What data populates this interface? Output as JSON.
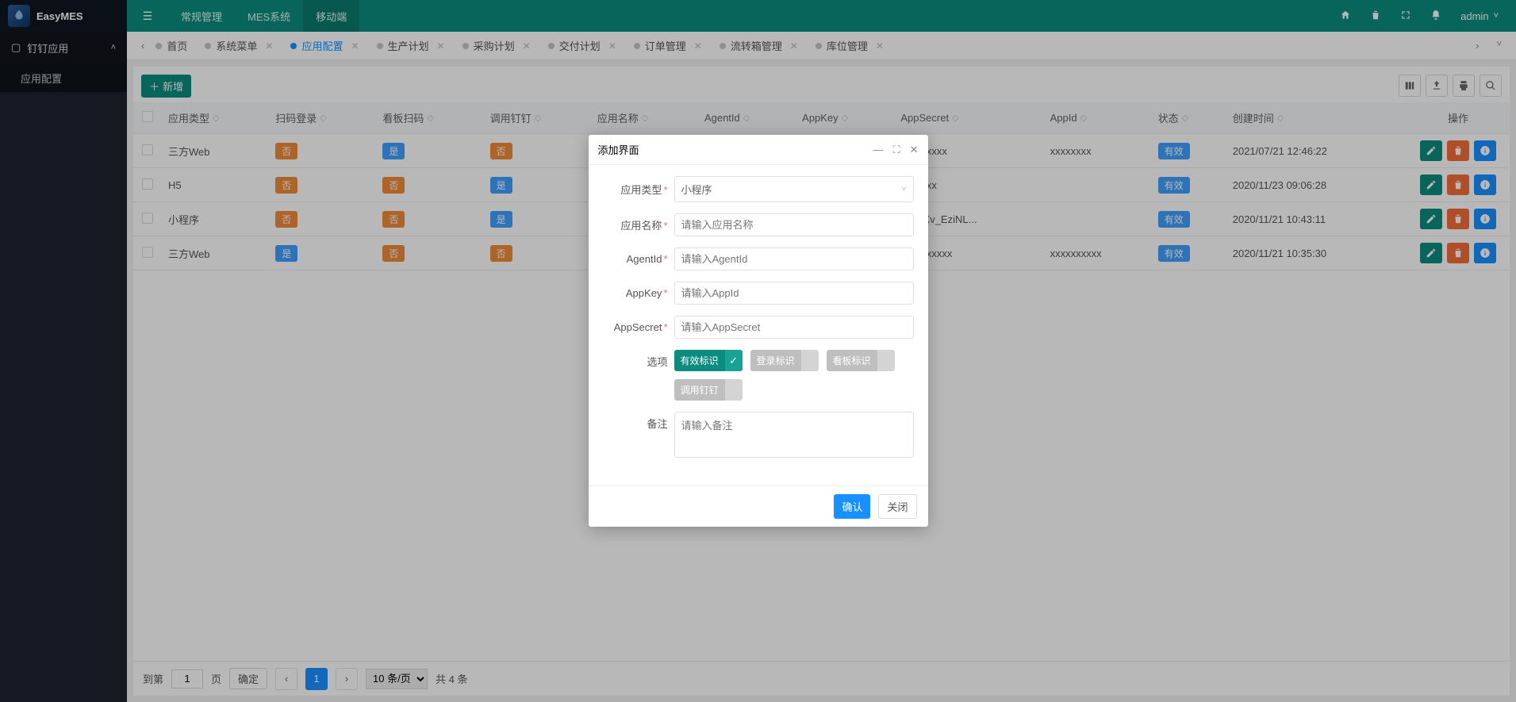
{
  "brand": "EasyMES",
  "sidebar": {
    "group": "钉钉应用",
    "items": [
      {
        "label": "应用配置"
      }
    ]
  },
  "nav": {
    "tabs": [
      "常规管理",
      "MES系统",
      "移动端"
    ],
    "activeIndex": 2
  },
  "user": {
    "name": "admin"
  },
  "pageTabs": {
    "items": [
      {
        "label": "首页",
        "closable": false
      },
      {
        "label": "系统菜单",
        "closable": true
      },
      {
        "label": "应用配置",
        "closable": true,
        "active": true
      },
      {
        "label": "生产计划",
        "closable": true
      },
      {
        "label": "采购计划",
        "closable": true
      },
      {
        "label": "交付计划",
        "closable": true
      },
      {
        "label": "订单管理",
        "closable": true
      },
      {
        "label": "流转箱管理",
        "closable": true
      },
      {
        "label": "库位管理",
        "closable": true
      }
    ]
  },
  "toolbar": {
    "addLabel": "新增"
  },
  "table": {
    "columns": [
      "应用类型",
      "扫码登录",
      "看板扫码",
      "调用钉钉",
      "应用名称",
      "AgentId",
      "AppKey",
      "AppSecret",
      "AppId",
      "状态",
      "创建时间",
      "操作"
    ],
    "rows": [
      {
        "appType": "三方Web",
        "scanLogin": "否",
        "boardScan": "是",
        "callDing": "否",
        "appName": "",
        "agentId": "",
        "appKey": "",
        "appSecret": "xxxxxxxxx",
        "appId": "xxxxxxxx",
        "status": "有效",
        "created": "2021/07/21 12:46:22"
      },
      {
        "appType": "H5",
        "scanLogin": "否",
        "boardScan": "否",
        "callDing": "是",
        "appName": "",
        "agentId": "",
        "appKey": "",
        "appSecret": "xxxxxxx",
        "appId": "",
        "status": "有效",
        "created": "2020/11/23 09:06:28"
      },
      {
        "appType": "小程序",
        "scanLogin": "否",
        "boardScan": "否",
        "callDing": "是",
        "appName": "",
        "agentId": "",
        "appKey": "",
        "appSecret": "RUCXv_EziNL...",
        "appId": "",
        "status": "有效",
        "created": "2020/11/21 10:43:11"
      },
      {
        "appType": "三方Web",
        "scanLogin": "是",
        "boardScan": "否",
        "callDing": "否",
        "appName": "",
        "agentId": "",
        "appKey": "",
        "appSecret": "xxxxxxxxxx",
        "appId": "xxxxxxxxxx",
        "status": "有效",
        "created": "2020/11/21 10:35:30"
      }
    ],
    "tag_yes": "是",
    "tag_no": "否"
  },
  "pager": {
    "gotoLabel": "到第",
    "pageLabel": "页",
    "confirm": "确定",
    "current": "1",
    "perPage": "10 条/页",
    "total": "共 4 条"
  },
  "modal": {
    "title": "添加界面",
    "fields": {
      "appType": {
        "label": "应用类型",
        "value": "小程序"
      },
      "appName": {
        "label": "应用名称",
        "placeholder": "请输入应用名称"
      },
      "agentId": {
        "label": "AgentId",
        "placeholder": "请输入AgentId"
      },
      "appKey": {
        "label": "AppKey",
        "placeholder": "请输入AppId"
      },
      "appSecret": {
        "label": "AppSecret",
        "placeholder": "请输入AppSecret"
      },
      "options": {
        "label": "选项"
      },
      "remark": {
        "label": "备注",
        "placeholder": "请输入备注"
      }
    },
    "switches": {
      "valid": "有效标识",
      "loginFlag": "登录标识",
      "boardFlag": "看板标识",
      "callDing": "调用钉钉"
    },
    "confirm": "确认",
    "cancel": "关闭"
  }
}
